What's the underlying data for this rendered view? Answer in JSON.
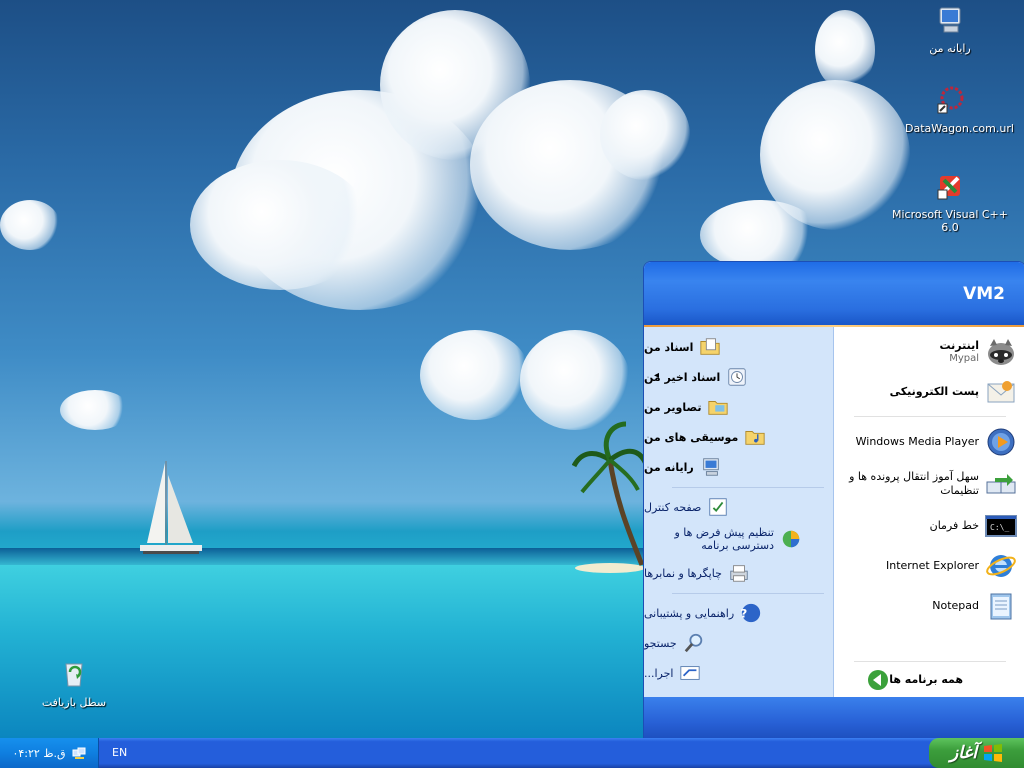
{
  "desktop": {
    "icons": [
      {
        "label": "رایانه من",
        "icon": "my-computer-icon"
      },
      {
        "label": "DataWagon.com.url",
        "icon": "internet-shortcut-icon"
      },
      {
        "label": "Microsoft Visual C++ 6.0",
        "icon": "visual-cpp-icon"
      },
      {
        "label": "سطل بازیافت",
        "icon": "recycle-bin-icon"
      }
    ]
  },
  "start_menu": {
    "user_name": "VM2",
    "pinned": [
      {
        "title": "اینترنت",
        "subtitle": "Mypal",
        "icon": "mypal-raccoon-icon"
      },
      {
        "title": "پست الکترونیکی",
        "icon": "email-envelope-icon"
      }
    ],
    "recent": [
      {
        "title": "Windows Media Player",
        "icon": "media-player-icon"
      },
      {
        "title": "سهل آموز انتقال پرونده ها و تنظیمات",
        "icon": "files-transfer-icon"
      },
      {
        "title": "خط فرمان",
        "icon": "command-prompt-icon"
      },
      {
        "title": "Internet Explorer",
        "icon": "internet-explorer-icon"
      },
      {
        "title": "Notepad",
        "icon": "notepad-icon"
      }
    ],
    "all_programs": "همه برنامه ها",
    "places": [
      {
        "label": "اسناد من",
        "icon": "my-documents-icon",
        "bold": true
      },
      {
        "label": "اسناد اخیر من",
        "icon": "recent-documents-icon",
        "bold": true,
        "submenu": true
      },
      {
        "label": "تصاویر من",
        "icon": "my-pictures-icon",
        "bold": true
      },
      {
        "label": "موسیقی های من",
        "icon": "my-music-icon",
        "bold": true
      },
      {
        "label": "رایانه من",
        "icon": "my-computer-icon",
        "bold": true
      }
    ],
    "system": [
      {
        "label": "صفحه کنترل",
        "icon": "control-panel-icon"
      },
      {
        "label": "تنظیم پیش فرض ها و دسترسی برنامه",
        "icon": "program-defaults-icon"
      },
      {
        "label": "چاپگرها و نمابرها",
        "icon": "printers-icon"
      }
    ],
    "help": [
      {
        "label": "راهنمایی و پشتیبانی",
        "icon": "help-icon"
      },
      {
        "label": "جستجو",
        "icon": "search-icon"
      },
      {
        "label": "اجرا...",
        "icon": "run-icon"
      }
    ],
    "submenu_arrow": "◂"
  },
  "taskbar": {
    "start_label": "آغاز",
    "language": "EN",
    "clock": "۰۴:۲۲ ق.ظ"
  }
}
